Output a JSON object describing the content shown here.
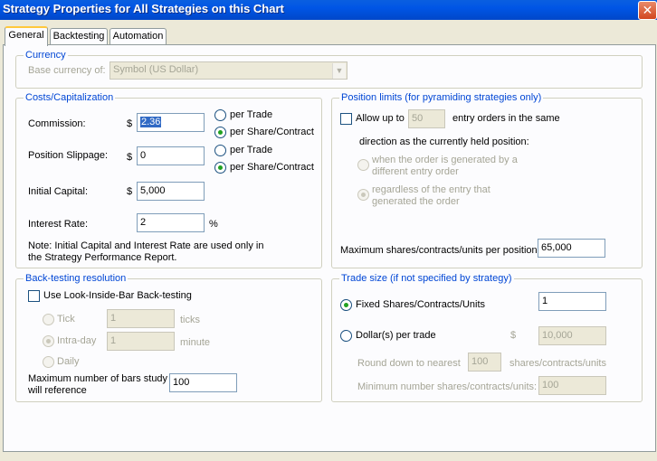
{
  "window": {
    "title": "Strategy Properties for All Strategies on this Chart"
  },
  "tabs": [
    "General",
    "Backtesting",
    "Automation"
  ],
  "currency": {
    "legend": "Currency",
    "base_label": "Base currency of:",
    "base_value": "Symbol (US Dollar)"
  },
  "costs": {
    "legend": "Costs/Capitalization",
    "commission_label": "Commission:",
    "commission_currency": "$",
    "commission_value": "2.36",
    "commission_per_trade": "per Trade",
    "commission_per_share": "per Share/Contract",
    "slippage_label": "Position Slippage:",
    "slippage_currency": "$",
    "slippage_value": "0",
    "slippage_per_trade": "per Trade",
    "slippage_per_share": "per Share/Contract",
    "capital_label": "Initial Capital:",
    "capital_currency": "$",
    "capital_value": "5,000",
    "interest_label": "Interest Rate:",
    "interest_value": "2",
    "interest_unit": "%",
    "note_line1": "Note: Initial Capital and Interest Rate are used only in",
    "note_line2": "the Strategy Performance Report."
  },
  "position_limits": {
    "legend": "Position limits (for pyramiding strategies only)",
    "allow_label": "Allow up to",
    "allow_value": "50",
    "allow_suffix": "entry orders in the same",
    "direction_text": "direction as the currently held position:",
    "option1_line1": "when the order is generated by a",
    "option1_line2": "different entry order",
    "option2_line1": "regardless of the entry that",
    "option2_line2": "generated the order",
    "max_label": "Maximum shares/contracts/units per position",
    "max_value": "65,000"
  },
  "backtesting": {
    "legend": "Back-testing resolution",
    "lib_label": "Use Look-Inside-Bar Back-testing",
    "tick_label": "Tick",
    "tick_value": "1",
    "tick_unit": "ticks",
    "intraday_label": "Intra-day",
    "intraday_value": "1",
    "intraday_unit": "minute",
    "daily_label": "Daily",
    "maxbars_line1": "Maximum number of bars study",
    "maxbars_line2": "will reference",
    "maxbars_value": "100"
  },
  "trade_size": {
    "legend": "Trade size (if not specified by strategy)",
    "fixed_label": "Fixed Shares/Contracts/Units",
    "fixed_value": "1",
    "dollars_label": "Dollar(s) per trade",
    "dollars_currency": "$",
    "dollars_value": "10,000",
    "round_label": "Round down to nearest",
    "round_value": "100",
    "round_unit": "shares/contracts/units",
    "min_label": "Minimum number shares/contracts/units:",
    "min_value": "100"
  },
  "colors": {
    "title_bar": "#0055e5",
    "legend_text": "#0046d5",
    "dialog_bg": "#ece9d8"
  }
}
